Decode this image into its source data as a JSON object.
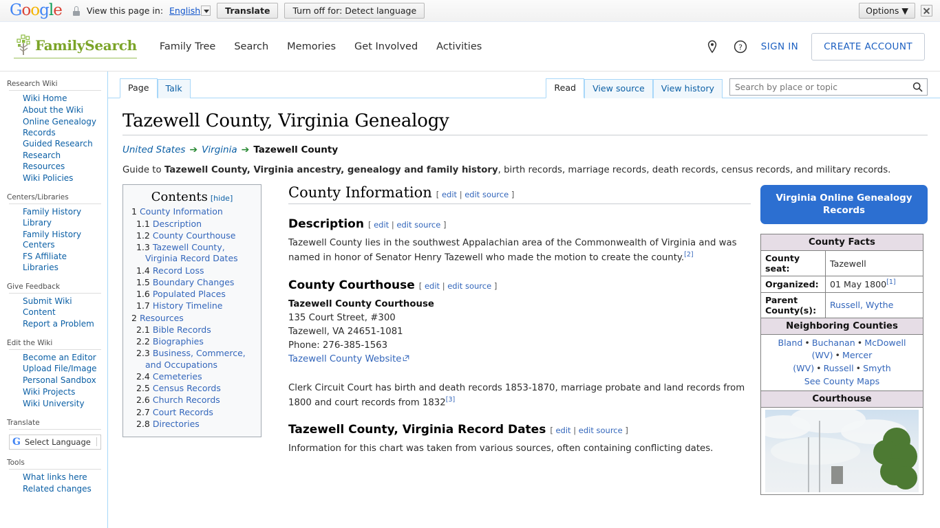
{
  "translate_bar": {
    "logo_letters": [
      "G",
      "o",
      "o",
      "g",
      "l",
      "e"
    ],
    "lock_icon": "lock-icon",
    "view_label": "View this page in:",
    "language": "English",
    "translate_button": "Translate",
    "turn_off_button": "Turn off for: Detect language",
    "options_button": "Options",
    "close_icon": "close-icon"
  },
  "header": {
    "brand": "FamilySearch",
    "nav": [
      "Family Tree",
      "Search",
      "Memories",
      "Get Involved",
      "Activities"
    ],
    "location_icon": "map-pin-icon",
    "help_icon": "question-circle-icon",
    "sign_in": "SIGN IN",
    "create_account": "CREATE ACCOUNT"
  },
  "sidebar": {
    "groups": [
      {
        "heading": "Research Wiki",
        "items": [
          "Wiki Home",
          "About the Wiki",
          "Online Genealogy Records",
          "Guided Research",
          "Research Resources",
          "Wiki Policies"
        ]
      },
      {
        "heading": "Centers/Libraries",
        "items": [
          "Family History Library",
          "Family History Centers",
          "FS Affiliate Libraries"
        ]
      },
      {
        "heading": "Give Feedback",
        "items": [
          "Submit Wiki Content",
          "Report a Problem"
        ]
      },
      {
        "heading": "Edit the Wiki",
        "items": [
          "Become an Editor",
          "Upload File/Image",
          "Personal Sandbox",
          "Wiki Projects",
          "Wiki University"
        ]
      },
      {
        "heading": "Translate",
        "items": []
      },
      {
        "heading": "Tools",
        "items": [
          "What links here",
          "Related changes"
        ]
      }
    ],
    "language_selector": {
      "icon": "google-g-icon",
      "label": "Select Language"
    }
  },
  "tabs": {
    "left": [
      {
        "label": "Page",
        "selected": true
      },
      {
        "label": "Talk",
        "selected": false
      }
    ],
    "right": [
      {
        "label": "Read",
        "selected": true
      },
      {
        "label": "View source",
        "selected": false
      },
      {
        "label": "View history",
        "selected": false
      }
    ]
  },
  "search": {
    "placeholder": "Search by place or topic",
    "value": "",
    "icon": "search-icon"
  },
  "article": {
    "title": "Tazewell County, Virginia Genealogy",
    "breadcrumb": {
      "items": [
        "United States",
        "Virginia"
      ],
      "current": "Tazewell County",
      "arrow": "➔"
    },
    "lede_prefix": "Guide to ",
    "lede_bold": "Tazewell County, Virginia ancestry, genealogy and family history",
    "lede_suffix": ", birth records, marriage records, death records, census records, and military records."
  },
  "toc": {
    "title": "Contents",
    "hide_label": "[hide]",
    "entries": [
      {
        "num": "1",
        "label": "County Information",
        "level": 1
      },
      {
        "num": "1.1",
        "label": "Description",
        "level": 2
      },
      {
        "num": "1.2",
        "label": "County Courthouse",
        "level": 2
      },
      {
        "num": "1.3",
        "label": "Tazewell County, Virginia Record Dates",
        "level": 2
      },
      {
        "num": "1.4",
        "label": "Record Loss",
        "level": 2
      },
      {
        "num": "1.5",
        "label": "Boundary Changes",
        "level": 2
      },
      {
        "num": "1.6",
        "label": "Populated Places",
        "level": 2
      },
      {
        "num": "1.7",
        "label": "History Timeline",
        "level": 2
      },
      {
        "num": "2",
        "label": "Resources",
        "level": 1
      },
      {
        "num": "2.1",
        "label": "Bible Records",
        "level": 2
      },
      {
        "num": "2.2",
        "label": "Biographies",
        "level": 2
      },
      {
        "num": "2.3",
        "label": "Business, Commerce, and Occupations",
        "level": 2
      },
      {
        "num": "2.4",
        "label": "Cemeteries",
        "level": 2
      },
      {
        "num": "2.5",
        "label": "Census Records",
        "level": 2
      },
      {
        "num": "2.6",
        "label": "Church Records",
        "level": 2
      },
      {
        "num": "2.7",
        "label": "Court Records",
        "level": 2
      },
      {
        "num": "2.8",
        "label": "Directories",
        "level": 2
      }
    ]
  },
  "edit_links": {
    "open": "[",
    "edit": "edit",
    "sep": "|",
    "edit_source": "edit source",
    "close": "]"
  },
  "sections": {
    "county_information": {
      "heading": "County Information"
    },
    "description": {
      "heading": "Description",
      "text": "Tazewell County lies in the southwest Appalachian area of the Commonwealth of Virginia and was named in honor of Senator Henry Tazewell who made the motion to create the county.",
      "ref": "[2]"
    },
    "courthouse": {
      "heading": "County Courthouse",
      "name": "Tazewell County Courthouse",
      "street": "135 Court Street, #300",
      "citystate": "Tazewell, VA 24651-1081",
      "phone": "Phone: 276-385-1563",
      "website_link": "Tazewell County Website",
      "external_icon": "external-link-icon",
      "clerk_text": "Clerk Circuit Court has birth and death records 1853-1870, marriage probate and land records from 1800 and court records from 1832",
      "clerk_ref": "[3]"
    },
    "record_dates": {
      "heading": "Tazewell County, Virginia Record Dates",
      "text": "Information for this chart was taken from various sources, often containing conflicting dates."
    }
  },
  "infobox": {
    "button": "Virginia Online Genealogy Records",
    "facts_header": "County Facts",
    "rows": [
      {
        "label": "County seat:",
        "value": "Tazewell",
        "ref": ""
      },
      {
        "label": "Organized:",
        "value": "01 May 1800",
        "ref": "[1]"
      },
      {
        "label": "Parent County(s):",
        "value": "Russell, Wythe",
        "ref": ""
      }
    ],
    "neighboring_header": "Neighboring Counties",
    "neighbors": [
      "Bland",
      "Buchanan",
      "McDowell (WV)",
      "Mercer (WV)",
      "Russell",
      "Smyth"
    ],
    "neighbor_separator": "•",
    "see_maps": "See County Maps",
    "courthouse_header": "Courthouse",
    "courthouse_photo": "courthouse-photo"
  },
  "colors": {
    "link": "#3366bb",
    "sidebar_link": "#0b5fa5",
    "brand_green": "#7ba428",
    "accent_blue": "#2c6fd1",
    "table_header": "#e6dde6",
    "tab_border": "#a7d7f9"
  }
}
